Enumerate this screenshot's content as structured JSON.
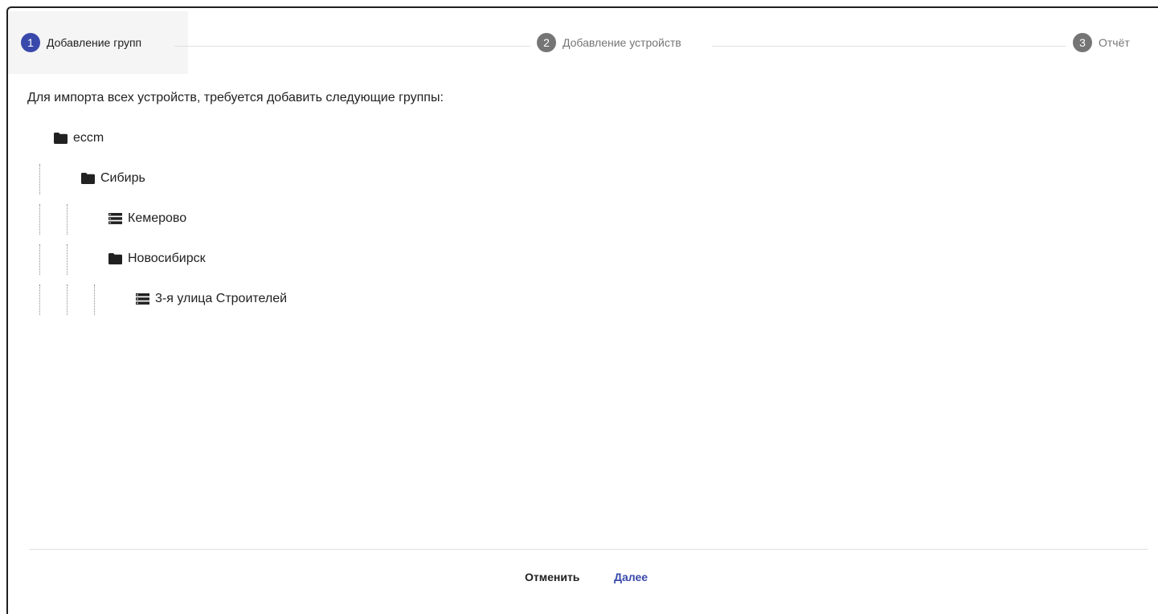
{
  "colors": {
    "active_step": "#3949ab",
    "inactive_step": "#757575",
    "text": "#212121",
    "muted": "#757575",
    "primary_link": "#3949ab"
  },
  "stepper": {
    "steps": [
      {
        "number": "1",
        "label": "Добавление групп",
        "active": true
      },
      {
        "number": "2",
        "label": "Добавление устройств",
        "active": false
      },
      {
        "number": "3",
        "label": "Отчёт",
        "active": false
      }
    ]
  },
  "intro_text": "Для импорта всех устройств, требуется добавить следующие группы:",
  "tree": {
    "nodes": [
      {
        "label": "eccm",
        "icon": "folder-icon",
        "level": 0
      },
      {
        "label": "Сибирь",
        "icon": "folder-icon",
        "level": 1
      },
      {
        "label": "Кемерово",
        "icon": "list-icon",
        "level": 2
      },
      {
        "label": "Новосибирск",
        "icon": "folder-icon",
        "level": 2
      },
      {
        "label": "3-я улица Строителей",
        "icon": "list-icon",
        "level": 3
      }
    ]
  },
  "footer": {
    "cancel_label": "Отменить",
    "next_label": "Далее"
  }
}
